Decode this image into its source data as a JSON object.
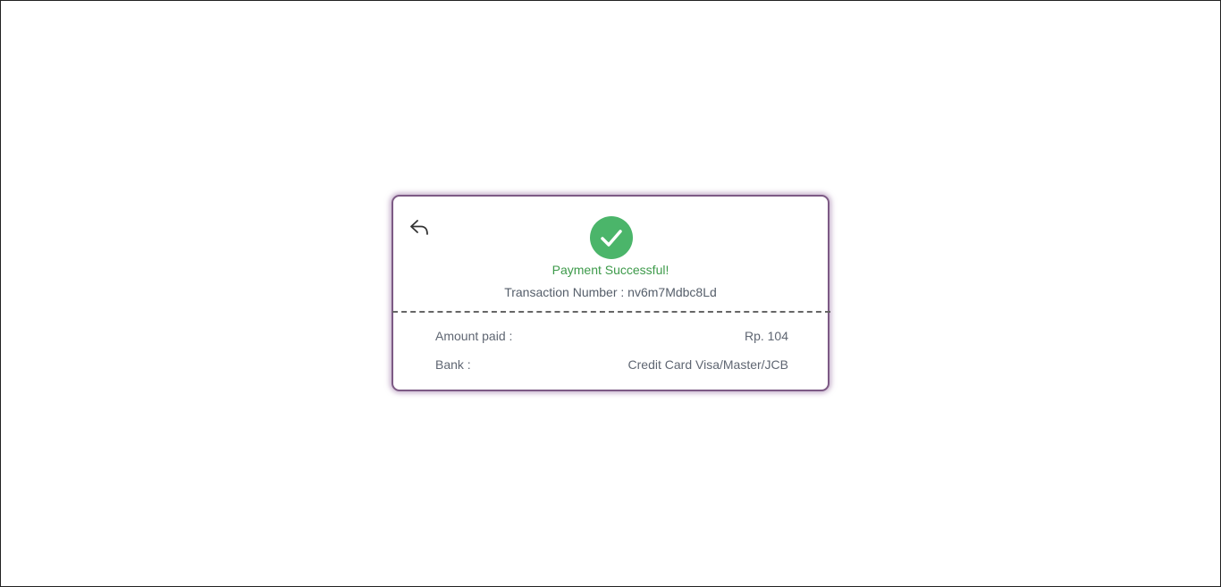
{
  "receipt": {
    "back_icon": "reply-arrow-icon",
    "success_icon": "check-circle-icon",
    "success_color": "#4bb56a",
    "status_text": "Payment Successful!",
    "status_color": "#3d9a4a",
    "transaction_label": "Transaction Number :",
    "transaction_number": "nv6m7Mdbc8Ld",
    "details": [
      {
        "label": "Amount paid :",
        "value": "Rp. 104"
      },
      {
        "label": "Bank :",
        "value": "Credit Card Visa/Master/JCB"
      }
    ]
  }
}
